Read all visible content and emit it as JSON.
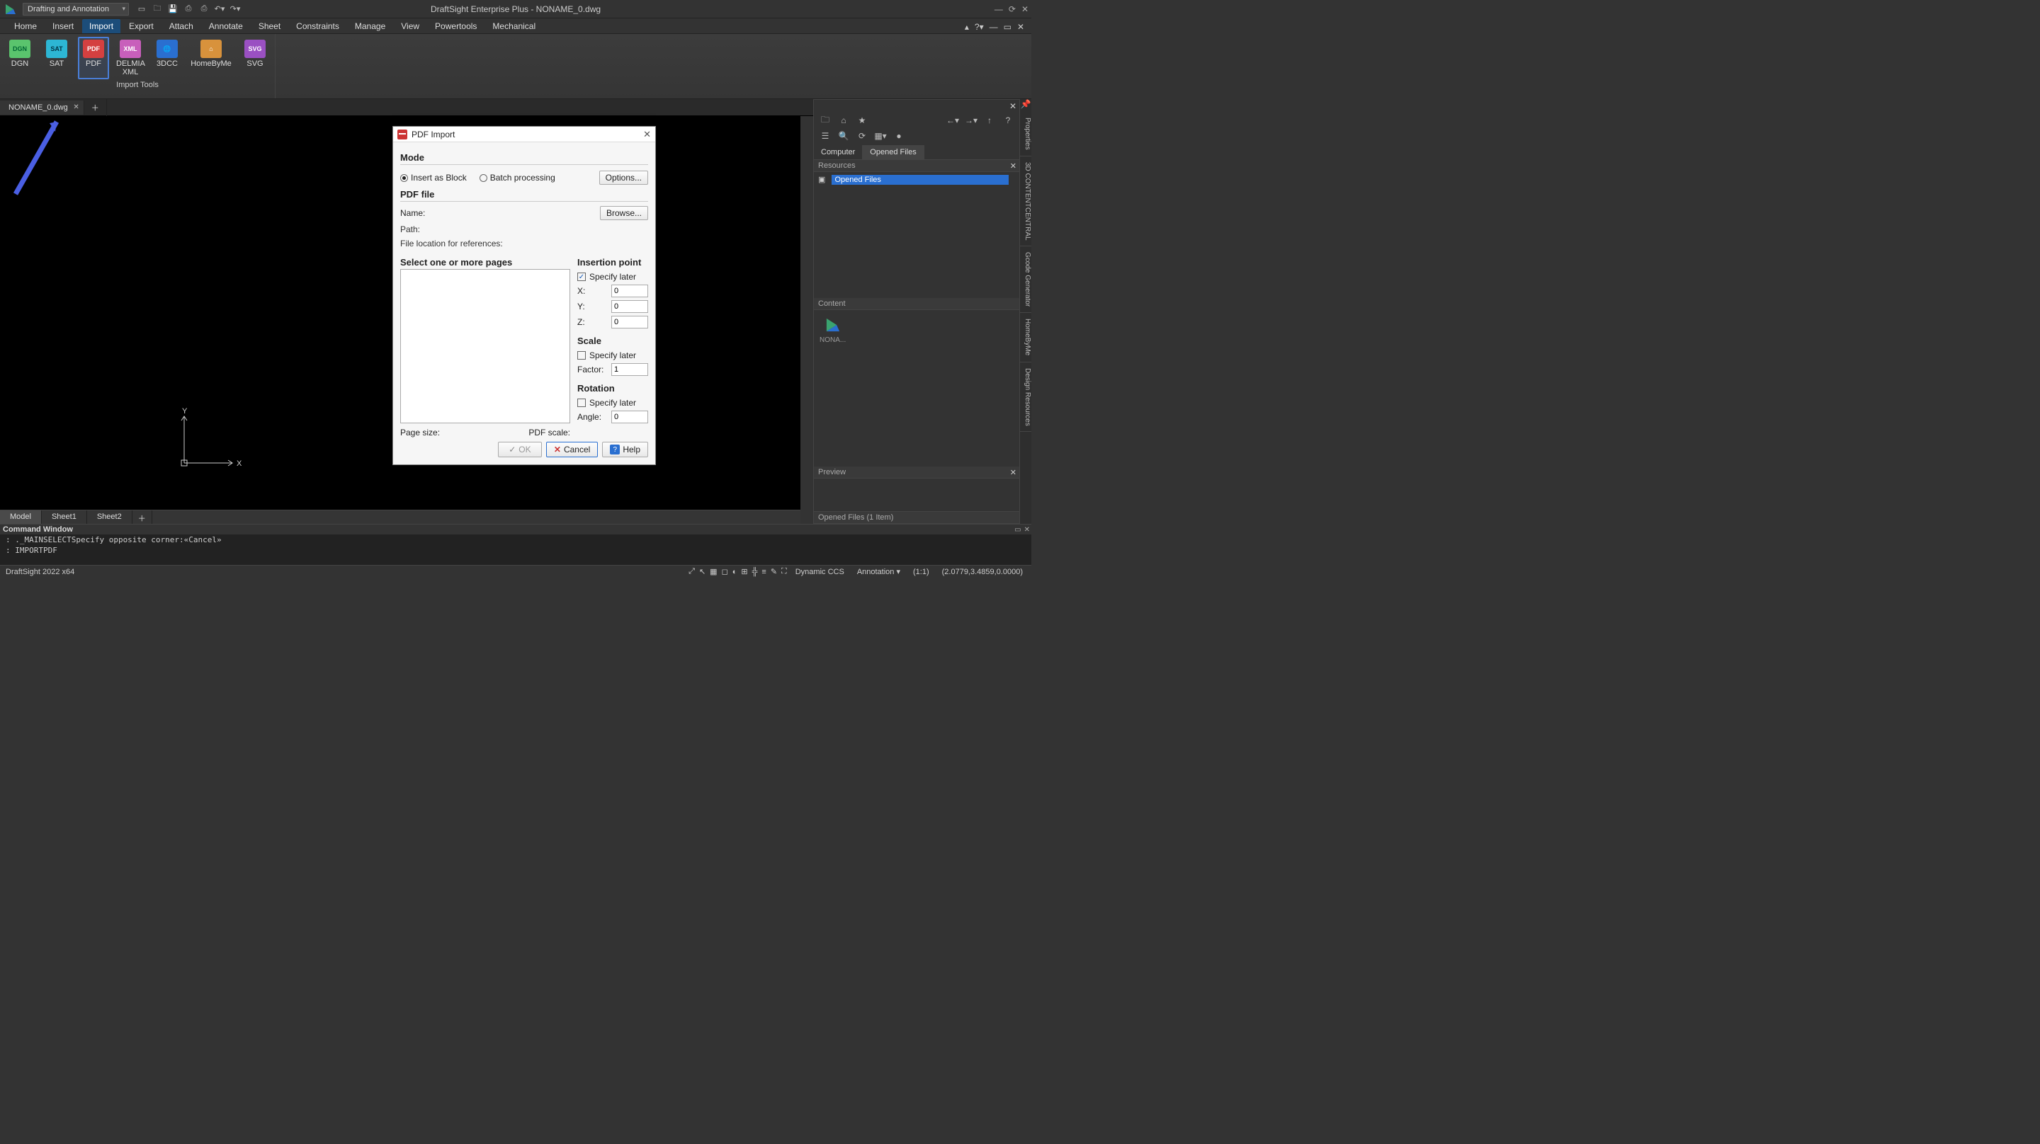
{
  "app": {
    "title": "DraftSight Enterprise Plus - NONAME_0.dwg",
    "workspace": "Drafting and Annotation"
  },
  "menu": {
    "items": [
      "Home",
      "Insert",
      "Import",
      "Export",
      "Attach",
      "Annotate",
      "Sheet",
      "Constraints",
      "Manage",
      "View",
      "Powertools",
      "Mechanical"
    ],
    "active_index": 2
  },
  "ribbon": {
    "group_title": "Import Tools",
    "items": [
      {
        "label": "DGN",
        "cls": "badge-dgn"
      },
      {
        "label": "SAT",
        "cls": "badge-sat"
      },
      {
        "label": "PDF",
        "cls": "badge-pdf",
        "selected": true
      },
      {
        "label": "DELMIA\nXML",
        "cls": "badge-xml"
      },
      {
        "label": "3DCC",
        "cls": "badge-3dcc"
      },
      {
        "label": "HomeByMe",
        "cls": "badge-home"
      },
      {
        "label": "SVG",
        "cls": "badge-svg"
      }
    ]
  },
  "doc_tab": {
    "name": "NONAME_0.dwg"
  },
  "model_tabs": [
    "Model",
    "Sheet1",
    "Sheet2"
  ],
  "command_window": {
    "title": "Command Window",
    "lines": [
      ": ._MAINSELECTSpecify opposite corner:«Cancel»",
      ": IMPORTPDF"
    ]
  },
  "statusbar": {
    "product": "DraftSight 2022 x64",
    "ccs": "Dynamic CCS",
    "scale": "Annotation",
    "ratio": "(1:1)",
    "coords": "(2.0779,3.4859,0.0000)"
  },
  "sidepanel": {
    "tabs": [
      "Computer",
      "Opened Files"
    ],
    "active_tab": 1,
    "resources_title": "Resources",
    "tree_root": "Opened Files",
    "content_title": "Content",
    "content_item": "NONA...",
    "preview_title": "Preview",
    "status": "Opened Files (1 Item)"
  },
  "edge_tabs": [
    "Properties",
    "3D CONTENTCENTRAL",
    "Gcode Generator",
    "HomeByMe",
    "Design Resources"
  ],
  "dialog": {
    "title": "PDF Import",
    "mode_title": "Mode",
    "mode": {
      "insert_block": "Insert as Block",
      "batch": "Batch processing",
      "options_btn": "Options..."
    },
    "pdf_file_title": "PDF file",
    "name_label": "Name:",
    "browse_btn": "Browse...",
    "path_label": "Path:",
    "file_loc": "File location for references:",
    "pages_title": "Select one or more pages",
    "insertion_title": "Insertion point",
    "specify_later": "Specify later",
    "x_label": "X:",
    "x_val": "0",
    "y_label": "Y:",
    "y_val": "0",
    "z_label": "Z:",
    "z_val": "0",
    "scale_title": "Scale",
    "factor_label": "Factor:",
    "factor_val": "1",
    "rotation_title": "Rotation",
    "angle_label": "Angle:",
    "angle_val": "0",
    "page_size_label": "Page size:",
    "pdf_scale_label": "PDF scale:",
    "ok": "OK",
    "cancel": "Cancel",
    "help": "Help"
  }
}
